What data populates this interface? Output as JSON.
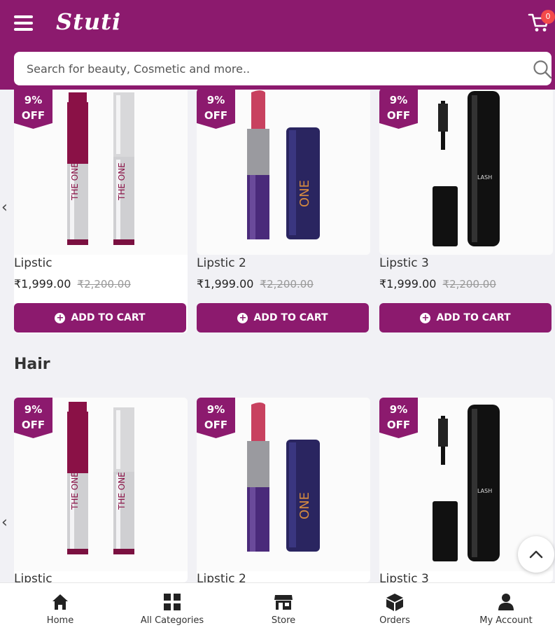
{
  "header": {
    "logo": "Stuti",
    "cart_count": "0",
    "search_placeholder": "Search for beauty, Cosmetic and more..",
    "menu_icon": "hamburger-icon",
    "cart_icon": "cart-icon",
    "search_icon": "search-icon",
    "accent_color": "#8c1a6e"
  },
  "sections": [
    {
      "title": "",
      "products": [
        {
          "discount": "9%",
          "discount_suffix": "OFF",
          "name": "Lipstic",
          "price": "₹1,999.00",
          "old_price": "₹2,200.00",
          "button": "ADD TO CART"
        },
        {
          "discount": "9%",
          "discount_suffix": "OFF",
          "name": "Lipstic 2",
          "price": "₹1,999.00",
          "old_price": "₹2,200.00",
          "button": "ADD TO CART"
        },
        {
          "discount": "9%",
          "discount_suffix": "OFF",
          "name": "Lipstic 3",
          "price": "₹1,999.00",
          "old_price": "₹2,200.00",
          "button": "ADD TO CART"
        }
      ]
    },
    {
      "title": "Hair",
      "products": [
        {
          "discount": "9%",
          "discount_suffix": "OFF",
          "name": "Lipstic"
        },
        {
          "discount": "9%",
          "discount_suffix": "OFF",
          "name": "Lipstic 2"
        },
        {
          "discount": "9%",
          "discount_suffix": "OFF",
          "name": "Lipstic 3"
        }
      ]
    }
  ],
  "bottom_nav": [
    {
      "label": "Home",
      "icon": "home-icon"
    },
    {
      "label": "All Categories",
      "icon": "grid-icon"
    },
    {
      "label": "Store",
      "icon": "store-icon"
    },
    {
      "label": "Orders",
      "icon": "box-icon"
    },
    {
      "label": "My Account",
      "icon": "user-icon"
    }
  ]
}
